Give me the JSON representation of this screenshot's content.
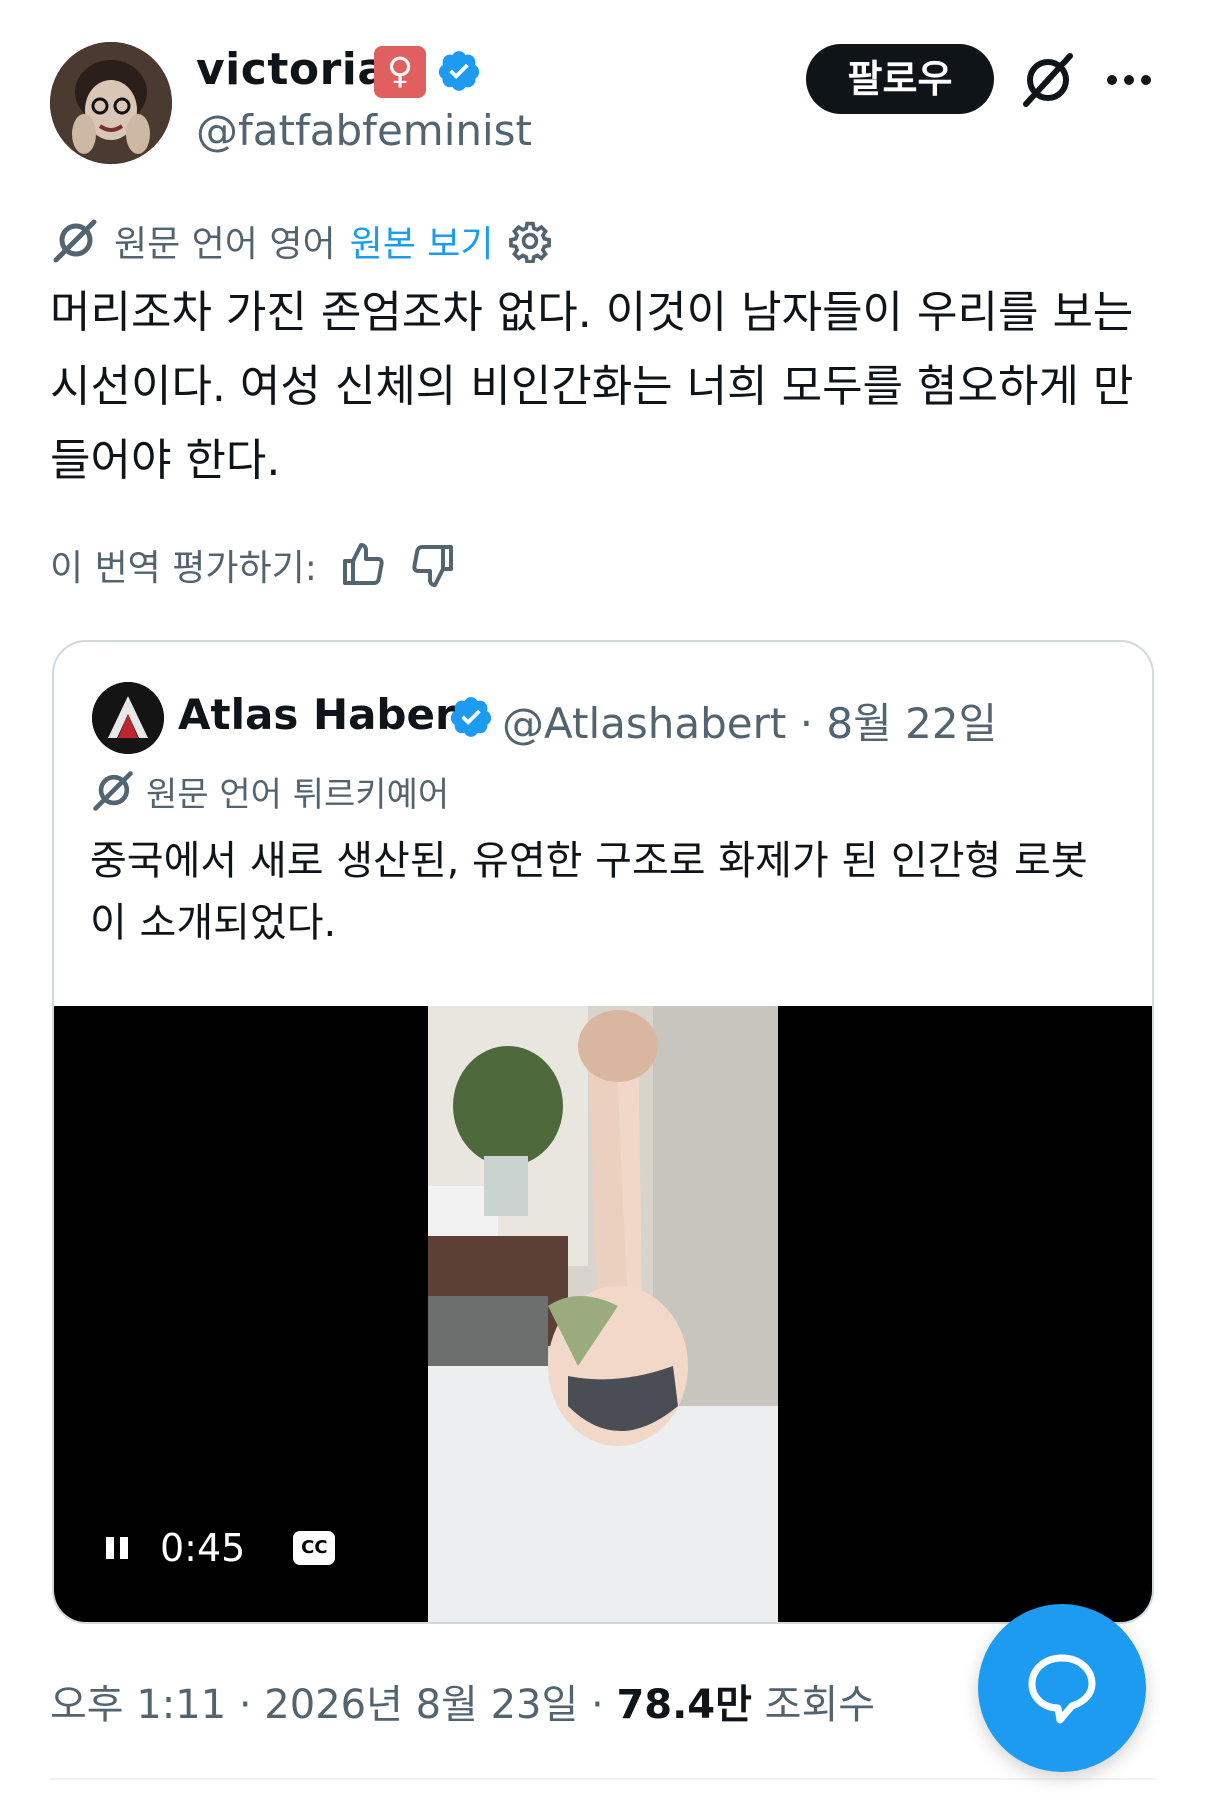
{
  "author": {
    "display_name": "victoria",
    "badge_emoji": "♀",
    "handle": "@fatfabfeminist"
  },
  "header": {
    "follow_label": "팔로우"
  },
  "translation": {
    "source_label": "원문 언어 영어",
    "view_original": "원본 보기"
  },
  "tweet_text": "머리조차 가진 존엄조차 없다. 이것이 남자들이 우리를 보는 시선이다. 여성 신체의 비인간화는 너희 모두를 혐오하게 만들어야 한다.",
  "rating": {
    "label": "이 번역 평가하기:"
  },
  "quote": {
    "display_name": "Atlas Haber",
    "handle": "@Atlashabert",
    "date": "8월 22일",
    "translation_label": "원문 언어 튀르키예어",
    "text": "중국에서 새로 생산된, 유연한 구조로 화제가 된 인간형 로봇이 소개되었다.",
    "video": {
      "time": "0:45",
      "cc_label": "CC"
    }
  },
  "footer": {
    "time": "오후 1:11",
    "date": "2026년 8월 23일",
    "views_count": "78.4만",
    "views_label": "조회수"
  },
  "colors": {
    "accent": "#1d9bf0",
    "text": "#0f1419",
    "secondary": "#536471",
    "border": "#cfd9de"
  }
}
